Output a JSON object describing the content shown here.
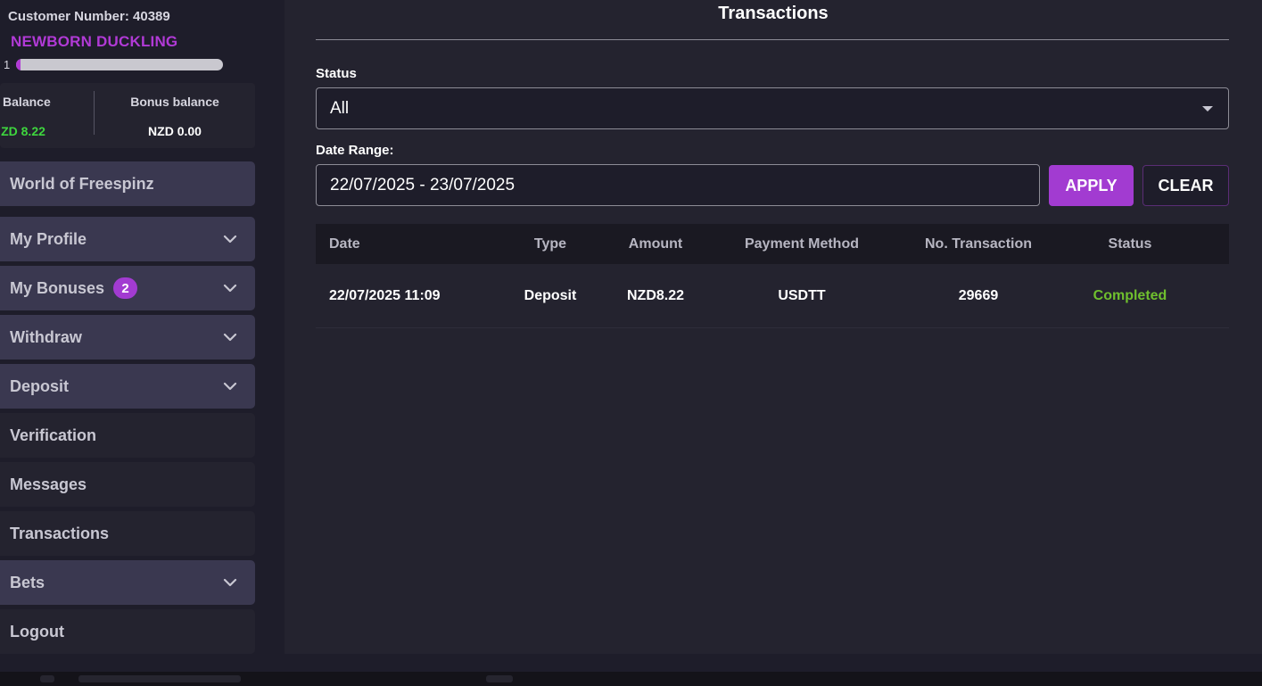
{
  "profile": {
    "customer_number": "Customer Number: 40389",
    "level_name": "NEWBORN DUCKLING",
    "level_number": "1",
    "level_progress_pct": 2
  },
  "balances": {
    "real_label": "l Balance",
    "real_value": "ZD 8.22",
    "bonus_label": "Bonus balance",
    "bonus_value": "NZD 0.00"
  },
  "menu": {
    "world": "World of Freespinz",
    "profile": "My Profile",
    "bonuses": "My Bonuses",
    "bonuses_badge": "2",
    "withdraw": "Withdraw",
    "deposit": "Deposit",
    "verification": "Verification",
    "messages": "Messages",
    "transactions": "Transactions",
    "bets": "Bets",
    "logout": "Logout"
  },
  "page": {
    "title": "Transactions"
  },
  "filters": {
    "status_label": "Status",
    "status_value": "All",
    "date_label": "Date Range:",
    "date_value": "22/07/2025 - 23/07/2025",
    "apply": "APPLY",
    "clear": "CLEAR"
  },
  "table": {
    "headers": {
      "date": "Date",
      "type": "Type",
      "amount": "Amount",
      "method": "Payment Method",
      "number": "No. Transaction",
      "status": "Status"
    },
    "rows": [
      {
        "date": "22/07/2025 11:09",
        "type": "Deposit",
        "amount": "NZD8.22",
        "method": "USDTT",
        "number": "29669",
        "status": "Completed"
      }
    ]
  },
  "colors": {
    "accent": "#a23bd1",
    "level": "#b13ad6",
    "real_balance": "#3ed63e",
    "completed": "#6fbf2e"
  }
}
